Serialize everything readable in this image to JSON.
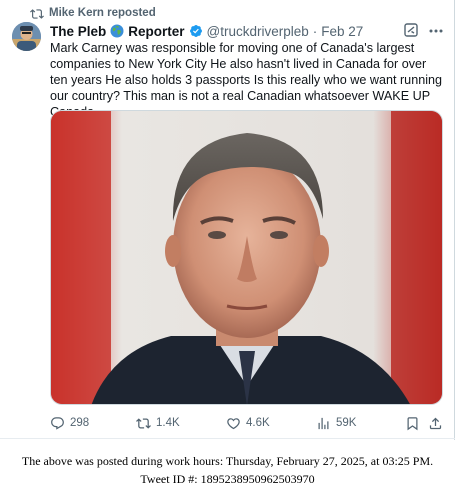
{
  "repost": {
    "text": "Mike Kern reposted"
  },
  "author": {
    "display_name_part1": "The Pleb",
    "display_name_part2": "Reporter",
    "handle": "@truckdriverpleb",
    "separator": "·",
    "date": "Feb 27"
  },
  "tweet": {
    "text": "Mark Carney was responsible for moving one of Canada's largest companies to New York City He also hasn't lived in Canada for over ten years He also holds 3 passports Is this really who we want running our country? This man is not a real Canadian whatsoever WAKE UP Canada"
  },
  "actions": {
    "replies": "298",
    "reposts": "1.4K",
    "likes": "4.6K",
    "views": "59K"
  },
  "footer": {
    "line1": "The above was posted during work hours: Thursday, February 27, 2025, at 03:25 PM.",
    "line2": "Tweet ID #: 1895238950962503970"
  },
  "colors": {
    "secondary_text": "#536471",
    "verified_blue": "#1d9bf0",
    "flag_red": "#d52b1e"
  },
  "icons": [
    "repost-icon",
    "earth-icon",
    "verified-icon",
    "grok-icon",
    "more-icon",
    "reply-icon",
    "like-icon",
    "views-icon",
    "bookmark-icon",
    "share-icon"
  ]
}
